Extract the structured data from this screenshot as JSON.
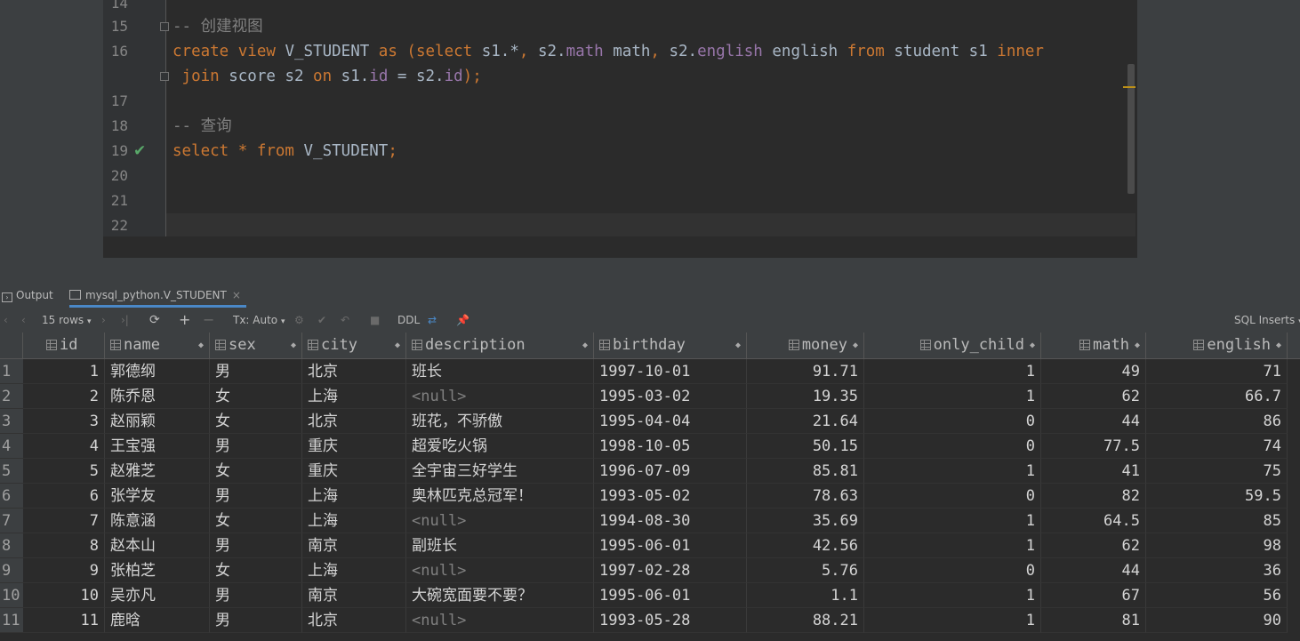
{
  "editor": {
    "lines": [
      {
        "num": "14",
        "text": ""
      },
      {
        "num": "15",
        "text": "-- 创建视图"
      },
      {
        "num": "16",
        "text": "create view V_STUDENT as (select s1.*, s2.math math, s2.english english from student s1 inner"
      },
      {
        "num": "",
        "text": " join score s2 on s1.id = s2.id);"
      },
      {
        "num": "17",
        "text": ""
      },
      {
        "num": "18",
        "text": "-- 查询"
      },
      {
        "num": "19",
        "text": "select * from V_STUDENT;"
      },
      {
        "num": "20",
        "text": ""
      },
      {
        "num": "21",
        "text": ""
      },
      {
        "num": "22",
        "text": ""
      }
    ],
    "tokens": {
      "l15": "-- 创建视图",
      "l16": [
        "create",
        " view ",
        "V_STUDENT",
        " as ",
        "(",
        "select",
        " s1.*",
        ", ",
        "s2.",
        "math",
        " math",
        ", ",
        "s2.",
        "english",
        " english ",
        "from",
        " student s1 ",
        "inner"
      ],
      "l16b": [
        " join",
        " score s2 ",
        "on",
        " s1.",
        "id",
        " = s2.",
        "id",
        ");"
      ],
      "l18": "-- 查询",
      "l19": [
        "select",
        " * ",
        "from",
        " V_STUDENT",
        ";"
      ]
    }
  },
  "tabs": {
    "output": "Output",
    "result": "mysql_python.V_STUDENT",
    "close": "×"
  },
  "toolbar": {
    "rows": "15 rows",
    "tx": "Tx: Auto",
    "ddl": "DDL",
    "sql_inserts": "SQL Inserts"
  },
  "table": {
    "columns": [
      "id",
      "name",
      "sex",
      "city",
      "description",
      "birthday",
      "money",
      "only_child",
      "math",
      "english"
    ],
    "rows": [
      [
        "1",
        "1",
        "郭德纲",
        "男",
        "北京",
        "班长",
        "1997-10-01",
        "91.71",
        "1",
        "49",
        "71"
      ],
      [
        "2",
        "2",
        "陈乔恩",
        "女",
        "上海",
        "<null>",
        "1995-03-02",
        "19.35",
        "1",
        "62",
        "66.7"
      ],
      [
        "3",
        "3",
        "赵丽颖",
        "女",
        "北京",
        "班花，不骄傲",
        "1995-04-04",
        "21.64",
        "0",
        "44",
        "86"
      ],
      [
        "4",
        "4",
        "王宝强",
        "男",
        "重庆",
        "超爱吃火锅",
        "1998-10-05",
        "50.15",
        "0",
        "77.5",
        "74"
      ],
      [
        "5",
        "5",
        "赵雅芝",
        "女",
        "重庆",
        "全宇宙三好学生",
        "1996-07-09",
        "85.81",
        "1",
        "41",
        "75"
      ],
      [
        "6",
        "6",
        "张学友",
        "男",
        "上海",
        "奥林匹克总冠军！",
        "1993-05-02",
        "78.63",
        "0",
        "82",
        "59.5"
      ],
      [
        "7",
        "7",
        "陈意涵",
        "女",
        "上海",
        "<null>",
        "1994-08-30",
        "35.69",
        "1",
        "64.5",
        "85"
      ],
      [
        "8",
        "8",
        "赵本山",
        "男",
        "南京",
        "副班长",
        "1995-06-01",
        "42.56",
        "1",
        "62",
        "98"
      ],
      [
        "9",
        "9",
        "张柏芝",
        "女",
        "上海",
        "<null>",
        "1997-02-28",
        "5.76",
        "0",
        "44",
        "36"
      ],
      [
        "10",
        "10",
        "吴亦凡",
        "男",
        "南京",
        "大碗宽面要不要？",
        "1995-06-01",
        "1.1",
        "1",
        "67",
        "56"
      ],
      [
        "11",
        "11",
        "鹿晗",
        "男",
        "北京",
        "<null>",
        "1993-05-28",
        "88.21",
        "1",
        "81",
        "90"
      ]
    ]
  }
}
